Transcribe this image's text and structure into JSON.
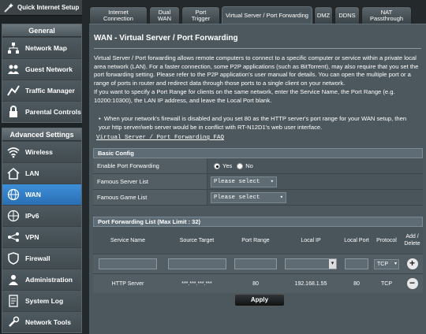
{
  "sidebar": {
    "quick_setup": "Quick Internet Setup",
    "general_title": "General",
    "general_items": [
      {
        "label": "Network Map"
      },
      {
        "label": "Guest Network"
      },
      {
        "label": "Traffic Manager"
      },
      {
        "label": "Parental Controls"
      }
    ],
    "advanced_title": "Advanced Settings",
    "advanced_items": [
      {
        "label": "Wireless"
      },
      {
        "label": "LAN"
      },
      {
        "label": "WAN"
      },
      {
        "label": "IPv6"
      },
      {
        "label": "VPN"
      },
      {
        "label": "Firewall"
      },
      {
        "label": "Administration"
      },
      {
        "label": "System Log"
      },
      {
        "label": "Network Tools"
      }
    ]
  },
  "tabs": [
    "Internet Connection",
    "Dual WAN",
    "Port Trigger",
    "Virtual Server / Port Forwarding",
    "DMZ",
    "DDNS",
    "NAT Passthrough"
  ],
  "page": {
    "title": "WAN - Virtual Server / Port Forwarding",
    "desc1": "Virtual Server / Port forwarding allows remote computers to connect to a specific computer or service within a private local area network (LAN). For a faster connection, some P2P applications (such as BitTorrent), may also require that you set the port forwarding setting. Please refer to the P2P application's user manual for details. You can open the multiple port or a range of ports in router and redirect data through those ports to a single client on your network.",
    "desc2": "If you want to specify a Port Range for clients on the same network, enter the Service Name, the Port Range (e.g. 10200:10300), the LAN IP address, and leave the Local Port blank.",
    "bullet": "When your network's firewall is disabled and you set 80 as the HTTP server's port range for your WAN setup, then your http server/web server would be in conflict with RT-N12D1's web user interface.",
    "faq": "Virtual Server / Port Forwarding FAQ"
  },
  "basic": {
    "title": "Basic Config",
    "enable_label": "Enable Port Forwarding",
    "yes": "Yes",
    "no": "No",
    "server_label": "Famous Server List",
    "server_value": "Please select",
    "game_label": "Famous Game List",
    "game_value": "Please select"
  },
  "pf": {
    "title": "Port Forwarding List (Max Limit : 32)",
    "headers": [
      "Service Name",
      "Source Target",
      "Port Range",
      "Local IP",
      "Local Port",
      "Protocol",
      "Add / Delete"
    ],
    "protocol_default": "TCP",
    "rows": [
      {
        "service": "HTTP Server",
        "source": "***.***.***.***",
        "port_range": "80",
        "local_ip": "192.168.1.55",
        "local_port": "80",
        "protocol": "TCP"
      }
    ]
  },
  "apply_label": "Apply"
}
